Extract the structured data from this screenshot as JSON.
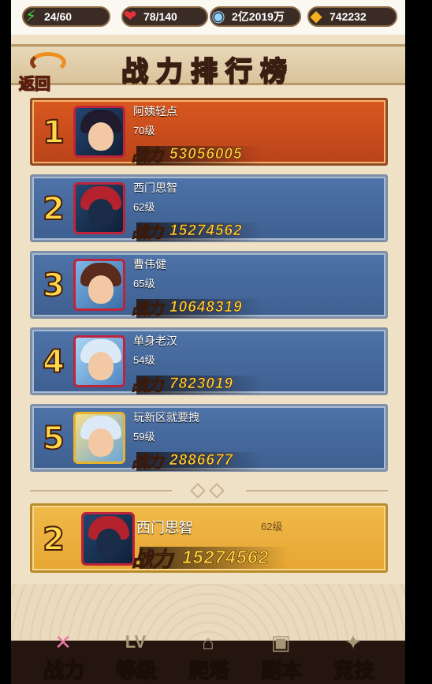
{
  "resources": {
    "energy": "24/60",
    "health": "78/140",
    "coins": "2亿2019万",
    "gold": "742232"
  },
  "header": {
    "title": "战力排行榜",
    "back_label": "返回"
  },
  "ranking": {
    "power_label": "战力",
    "rows": [
      {
        "rank": "1",
        "name": "阿姨轻点",
        "level": "70级",
        "power": "53056005"
      },
      {
        "rank": "2",
        "name": "西门思智",
        "level": "62级",
        "power": "15274562"
      },
      {
        "rank": "3",
        "name": "曹伟健",
        "level": "65级",
        "power": "10648319"
      },
      {
        "rank": "4",
        "name": "单身老汉",
        "level": "54级",
        "power": "7823019"
      },
      {
        "rank": "5",
        "name": "玩新区就要拽",
        "level": "59级",
        "power": "2886677"
      }
    ]
  },
  "my_rank": {
    "rank": "2",
    "name": "西门思智",
    "level": "62级",
    "power": "15274562"
  },
  "tabs": [
    {
      "label": "战力",
      "icon": "feather-icon"
    },
    {
      "label": "等级",
      "icon": "lv-icon"
    },
    {
      "label": "爬塔",
      "icon": "tower-icon"
    },
    {
      "label": "副本",
      "icon": "dungeon-icon"
    },
    {
      "label": "竞技",
      "icon": "arena-icon"
    }
  ],
  "tab_icon_text": {
    "lv": "LV"
  }
}
